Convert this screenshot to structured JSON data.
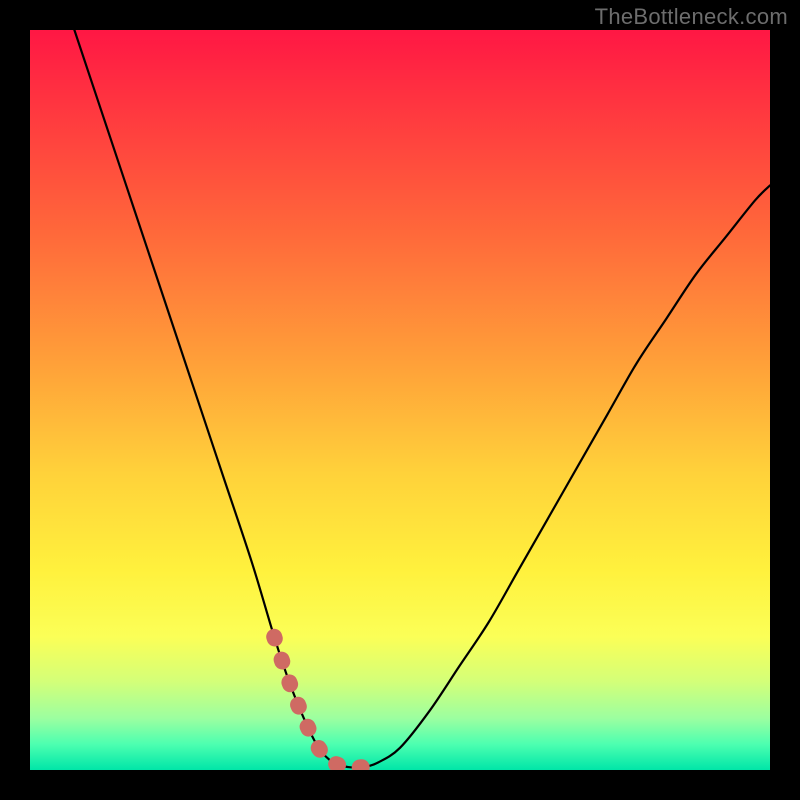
{
  "watermark": "TheBottleneck.com",
  "colors": {
    "frame": "#000000",
    "curve": "#000000",
    "highlight": "#cf6a63",
    "gradient_stops": [
      {
        "offset": 0.0,
        "color": "#ff1744"
      },
      {
        "offset": 0.12,
        "color": "#ff3b3f"
      },
      {
        "offset": 0.28,
        "color": "#ff6a3a"
      },
      {
        "offset": 0.45,
        "color": "#ffa039"
      },
      {
        "offset": 0.6,
        "color": "#ffd23a"
      },
      {
        "offset": 0.73,
        "color": "#fff13d"
      },
      {
        "offset": 0.82,
        "color": "#fbff57"
      },
      {
        "offset": 0.88,
        "color": "#d4ff78"
      },
      {
        "offset": 0.93,
        "color": "#9cffa0"
      },
      {
        "offset": 0.965,
        "color": "#4dffb0"
      },
      {
        "offset": 1.0,
        "color": "#00e6a8"
      }
    ]
  },
  "chart_data": {
    "type": "line",
    "title": "",
    "xlabel": "",
    "ylabel": "",
    "xlim": [
      0,
      100
    ],
    "ylim": [
      0,
      100
    ],
    "series": [
      {
        "name": "bottleneck-curve",
        "x": [
          6,
          10,
          14,
          18,
          22,
          26,
          30,
          33,
          35,
          37,
          39,
          41,
          43,
          45,
          47,
          50,
          54,
          58,
          62,
          66,
          70,
          74,
          78,
          82,
          86,
          90,
          94,
          98,
          100
        ],
        "y": [
          100,
          88,
          76,
          64,
          52,
          40,
          28,
          18,
          12,
          7,
          3,
          1,
          0.4,
          0.4,
          1,
          3,
          8,
          14,
          20,
          27,
          34,
          41,
          48,
          55,
          61,
          67,
          72,
          77,
          79
        ]
      }
    ],
    "highlight_range_x": [
      33,
      49
    ],
    "highlight_y_threshold": 5
  }
}
